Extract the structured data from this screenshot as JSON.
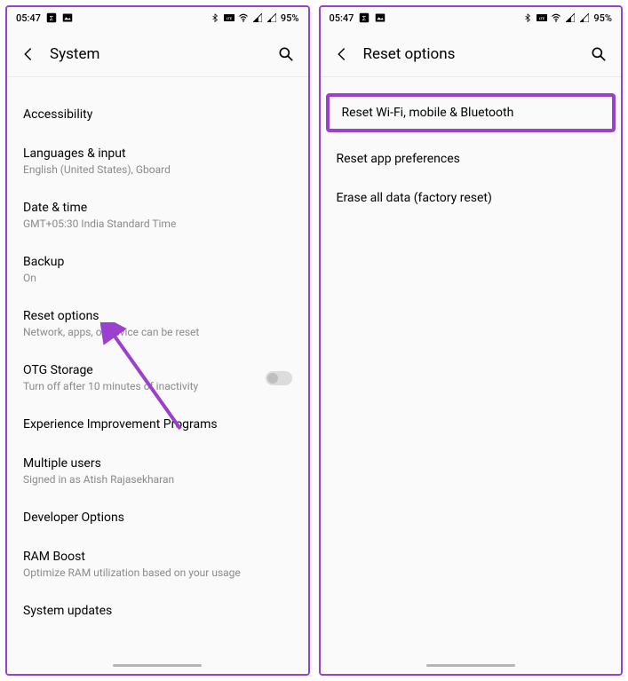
{
  "statusbar": {
    "time": "05:47",
    "battery": "95%"
  },
  "left_screen": {
    "header_title": "System",
    "items": [
      {
        "title": "Accessibility",
        "sub": ""
      },
      {
        "title": "Languages & input",
        "sub": "English (United States), Gboard"
      },
      {
        "title": "Date & time",
        "sub": "GMT+05:30 India Standard Time"
      },
      {
        "title": "Backup",
        "sub": "On"
      },
      {
        "title": "Reset options",
        "sub": "Network, apps, or device can be reset"
      },
      {
        "title": "OTG Storage",
        "sub": "Turn off after 10 minutes of inactivity",
        "toggle": true
      },
      {
        "title": "Experience Improvement Programs",
        "sub": ""
      },
      {
        "title": "Multiple users",
        "sub": "Signed in as Atish Rajasekharan"
      },
      {
        "title": "Developer Options",
        "sub": ""
      },
      {
        "title": "RAM Boost",
        "sub": "Optimize RAM utilization based on your usage"
      },
      {
        "title": "System updates",
        "sub": ""
      }
    ]
  },
  "right_screen": {
    "header_title": "Reset options",
    "items": [
      {
        "title": "Reset Wi-Fi, mobile & Bluetooth",
        "highlight": true
      },
      {
        "title": "Reset app preferences"
      },
      {
        "title": "Erase all data (factory reset)"
      }
    ]
  },
  "annotation": {
    "color": "#9b3fcf"
  }
}
